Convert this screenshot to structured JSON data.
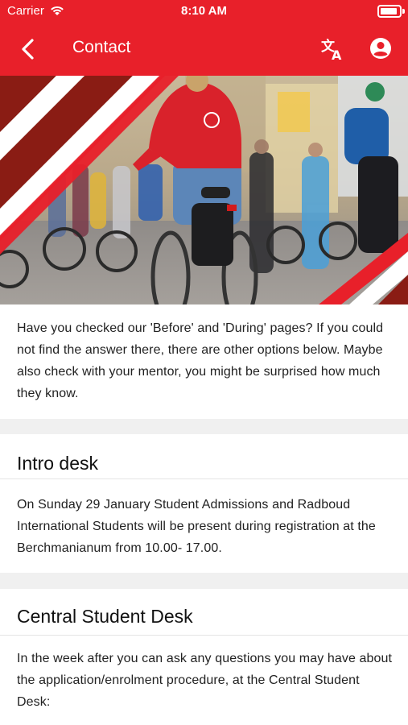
{
  "status_bar": {
    "carrier": "Carrier",
    "time": "8:10 AM"
  },
  "nav": {
    "title": "Contact",
    "icons": [
      "back-chevron-icon",
      "translate-icon",
      "account-circle-icon"
    ]
  },
  "colors": {
    "brand_red": "#e8202a",
    "background": "#f0f0f0",
    "card": "#ffffff"
  },
  "intro_text": "Have you checked our 'Before' and 'During' pages? If you could not find the answer there, there are other options below. Maybe also check with your mentor, you might be surprised how much they know.",
  "sections": [
    {
      "heading": "Intro desk",
      "body": "On Sunday 29 January Student Admissions and Radboud International Students will be present during registration at the Berchmanianum from 10.00- 17.00."
    },
    {
      "heading": "Central Student Desk",
      "body": "In the week after you can ask  any questions you may have about the application/enrolment procedure, at the Central Student Desk:"
    }
  ]
}
